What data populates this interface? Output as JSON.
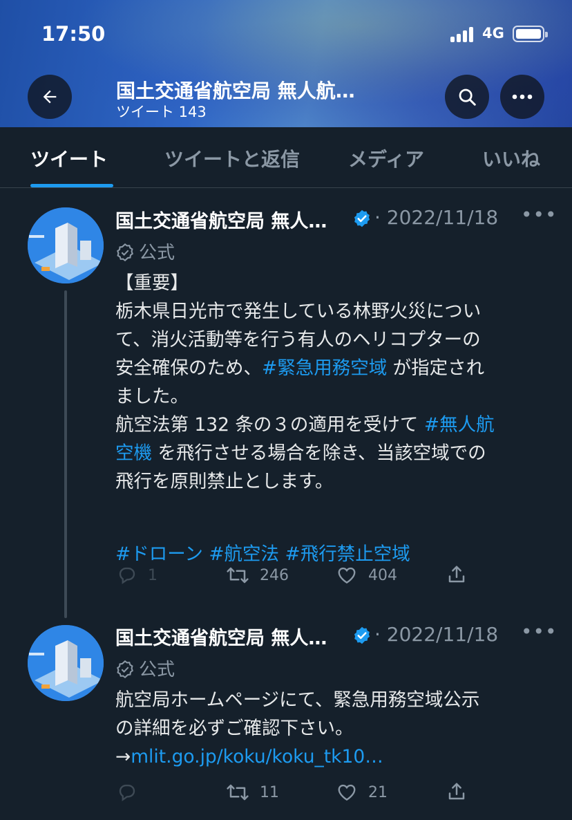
{
  "status_bar": {
    "time": "17:50",
    "network": "4G"
  },
  "header": {
    "title": "国土交通省航空局 無人航…",
    "subtitle": "ツイート 143"
  },
  "tabs": [
    {
      "label": "ツイート"
    },
    {
      "label": "ツイートと返信"
    },
    {
      "label": "メディア"
    },
    {
      "label": "いいね"
    }
  ],
  "tweets": [
    {
      "author": "国土交通省航空局 無人…",
      "date": "· 2022/11/18",
      "label": "公式",
      "lines": [
        [
          "【重要】"
        ],
        [
          "栃木県日光市で発生している林野火災につい"
        ],
        [
          "て、消火活動等を行う有人のヘリコプターの"
        ],
        [
          "安全確保のため、",
          "#緊急用務空域",
          " が指定され"
        ],
        [
          "ました。"
        ],
        [
          "航空法第 132 条の３の適用を受けて ",
          "#無人航"
        ],
        [
          "空機",
          " を飛行させる場合を除き、当該空域での"
        ],
        [
          "飛行を原則禁止とします。"
        ],
        [
          ""
        ],
        [
          "#ドローン",
          " ",
          "#航空法",
          " ",
          "#飛行禁止空域"
        ]
      ],
      "replies": "1",
      "retweets": "246",
      "likes": "404"
    },
    {
      "author": "国土交通省航空局 無人…",
      "date": "· 2022/11/18",
      "label": "公式",
      "lines": [
        [
          "航空局ホームページにて、緊急用務空域公示"
        ],
        [
          "の詳細を必ずご確認下さい。"
        ],
        [
          "→",
          "mlit.go.jp/koku/koku_tk10…"
        ]
      ],
      "replies": "",
      "retweets": "11",
      "likes": "21"
    }
  ],
  "colors": {
    "accent": "#1d9bf0",
    "background": "#15202b",
    "muted": "#8b98a5"
  },
  "icons": {
    "back": "arrow-left-icon",
    "search": "search-icon",
    "more": "more-icon",
    "verified": "verified-badge-icon",
    "official": "official-badge-icon",
    "reply": "reply-icon",
    "retweet": "retweet-icon",
    "like": "heart-icon",
    "share": "share-icon"
  }
}
